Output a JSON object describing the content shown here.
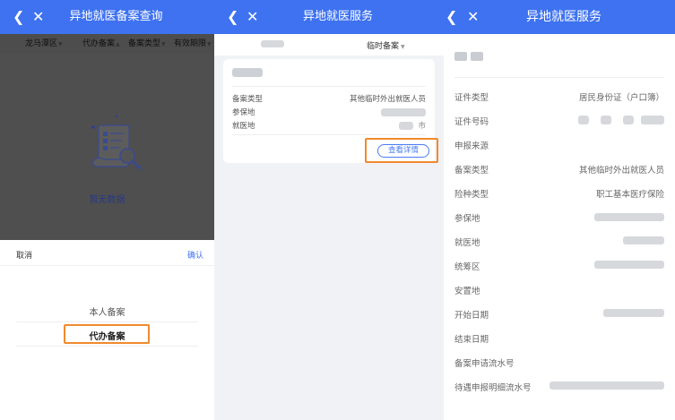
{
  "panel1": {
    "header": {
      "title": "异地就医备案查询"
    },
    "filters": [
      {
        "label": "龙马潭区"
      },
      {
        "label": "代办备案"
      },
      {
        "label": "备案类型"
      },
      {
        "label": "有效期限"
      }
    ],
    "empty_text": "暂无数据",
    "sheet": {
      "cancel_label": "取消",
      "confirm_label": "确认",
      "options": [
        "本人备案",
        "代办备案"
      ],
      "selected": "代办备案"
    }
  },
  "panel2": {
    "header": {
      "title": "异地就医服务"
    },
    "tab_right_label": "临时备案",
    "card": {
      "fields": [
        {
          "label": "备案类型",
          "value": "其他临时外出就医人员"
        },
        {
          "label": "参保地",
          "value": ""
        },
        {
          "label": "就医地",
          "value": "市"
        }
      ],
      "detail_label": "查看详情"
    }
  },
  "panel3": {
    "header": {
      "title": "异地就医服务"
    },
    "fields": [
      {
        "label": "证件类型",
        "value": "居民身份证（户口簿）"
      },
      {
        "label": "证件号码",
        "value": ""
      },
      {
        "label": "申报来源",
        "value": ""
      },
      {
        "label": "备案类型",
        "value": "其他临时外出就医人员"
      },
      {
        "label": "险种类型",
        "value": "职工基本医疗保险"
      },
      {
        "label": "参保地",
        "value": ""
      },
      {
        "label": "就医地",
        "value": ""
      },
      {
        "label": "统筹区",
        "value": ""
      },
      {
        "label": "安置地",
        "value": ""
      },
      {
        "label": "开始日期",
        "value": ""
      },
      {
        "label": "结束日期",
        "value": ""
      },
      {
        "label": "备案申请流水号",
        "value": ""
      },
      {
        "label": "待遇申报明细流水号",
        "value": ""
      }
    ]
  },
  "colors": {
    "primary": "#3e72f0",
    "highlight": "#f08a2d",
    "overlay": "#4f4f4f"
  },
  "icons": {
    "back": "chevron-left-icon",
    "close": "close-icon",
    "caret": "caret-down-icon"
  }
}
